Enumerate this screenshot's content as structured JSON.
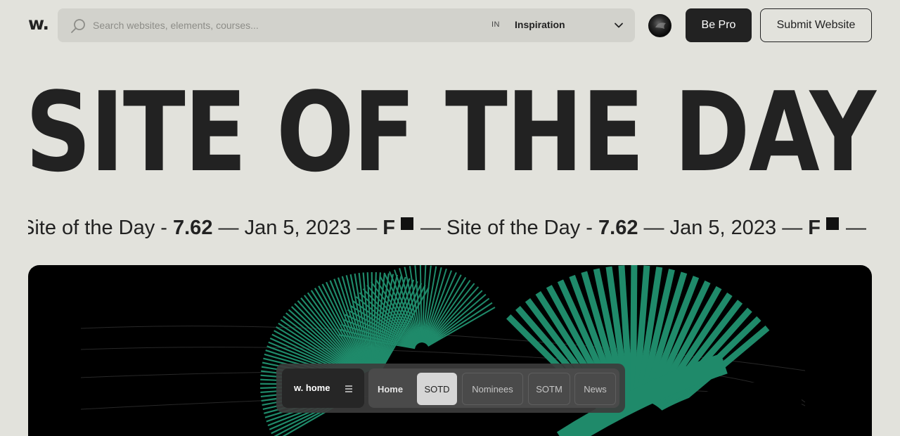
{
  "header": {
    "logo": "w.",
    "search": {
      "placeholder": "Search websites, elements, courses...",
      "value": "",
      "scope_prefix": "IN",
      "scope_value": "Inspiration"
    },
    "be_pro_label": "Be Pro",
    "submit_label": "Submit Website"
  },
  "hero": {
    "title": "SITE OF THE DAY"
  },
  "ticker": {
    "segments": [
      {
        "label": "Site of the Day - ",
        "score": "7.62",
        "date": " — Jan 5, 2023 — ",
        "site": "F"
      },
      {
        "label": " — Site of the Day - ",
        "score": "7.62",
        "date": " — Jan 5, 2023 — ",
        "site": "F"
      },
      {
        "label": " — Site o",
        "score": "",
        "date": "",
        "site": ""
      }
    ]
  },
  "bottom_nav": {
    "home_label": "w. home",
    "tabs": [
      {
        "label": "Home",
        "active": false
      },
      {
        "label": "SOTD",
        "active": true
      },
      {
        "label": "Nominees",
        "active": false
      },
      {
        "label": "SOTM",
        "active": false
      },
      {
        "label": "News",
        "active": false
      }
    ]
  },
  "colors": {
    "background": "#e2e2dc",
    "search_bg": "#d2d2cc",
    "primary_dark": "#222222",
    "feature_accent": "#1f8a6a"
  },
  "icons": {
    "search": "search-icon",
    "dropdown": "chevron-down-icon",
    "menu": "menu-icon",
    "square": "square-icon"
  }
}
